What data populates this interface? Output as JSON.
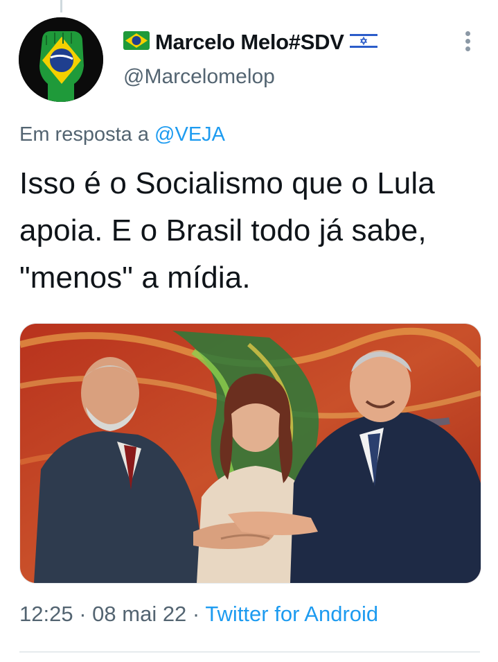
{
  "tweet": {
    "author": {
      "display_name": "Marcelo Melo#SDV",
      "handle": "@Marcelomelop",
      "name_prefix_emoji": "brazil-flag-icon",
      "name_suffix_emoji": "israel-flag-icon"
    },
    "reply_to": {
      "prefix": "Em resposta a",
      "mention": "@VEJA"
    },
    "text": "Isso é o Socialismo que o Lula apoia. E o Brasil todo já sabe, \"menos\" a mídia.",
    "time": "12:25",
    "date": "08 mai 22",
    "separator": "·",
    "source": "Twitter for Android"
  },
  "colors": {
    "text": "#0f1419",
    "secondary": "#536471",
    "link": "#1d9bf0",
    "divider": "#cfd9de"
  }
}
